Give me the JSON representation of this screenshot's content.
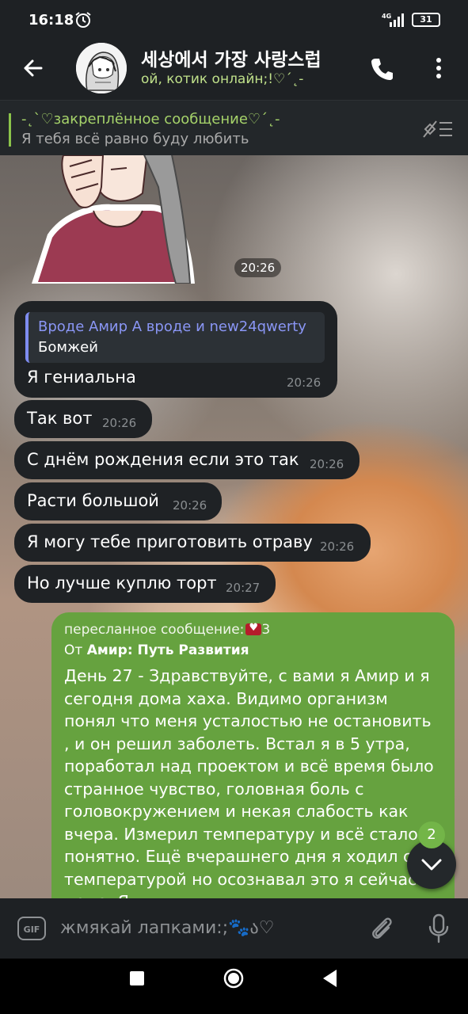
{
  "status_bar": {
    "time": "16:18",
    "network": "4G",
    "battery": "31"
  },
  "header": {
    "title": "세상에서 가장 사랑스럽",
    "status": "ой, котик онлайн;!♡´˛-"
  },
  "pinned": {
    "title": "-˛`♡закреплённое сообщение♡´˛-",
    "text": "Я тебя всё равно буду любить"
  },
  "messages": [
    {
      "type": "sticker",
      "time": "20:26"
    },
    {
      "type": "reply",
      "reply_name": "Вроде Амир А вроде и new24qwerty",
      "reply_text": "Бомжей",
      "text": "Я гениальна",
      "time": "20:26"
    },
    {
      "type": "text",
      "text": "Так вот",
      "time": "20:26"
    },
    {
      "type": "text",
      "text": "С днём рождения если это так",
      "time": "20:26"
    },
    {
      "type": "text",
      "text": "Расти большой",
      "time": "20:26"
    },
    {
      "type": "text",
      "text": "Я могу тебе приготовить отраву",
      "time": "20:26"
    },
    {
      "type": "text",
      "text": "Но лучше куплю торт",
      "time": "20:27"
    }
  ],
  "forwarded": {
    "label": "пересланное сообщение:",
    "label_suffix": "3",
    "from_prefix": "От",
    "from_name": "Амир: Путь Развития",
    "body": "День 27 - Здравствуйте, с вами я Амир и я сегодня дома хаха. Видимо организм понял что меня усталостью не остановить , и он решил заболеть. Встал я в 5 утра, поработал над проектом и всё время было странное чувство, головная боль с головокружением и некая слабость как вчера. Измерил температуру и всё стало понятно. Ещё вчерашнего дня я ходил с температурой но осознавал это я сейчас я дома. Я"
  },
  "unread_badge": "2",
  "input": {
    "placeholder": "жмякай лапками:;🐾ა♡",
    "gif_label": "GIF"
  },
  "colors": {
    "accent": "#8bc34a",
    "outgoing_bubble": "#66a23f",
    "incoming_bubble": "#1f2225",
    "reply_name": "#8a96f5"
  }
}
